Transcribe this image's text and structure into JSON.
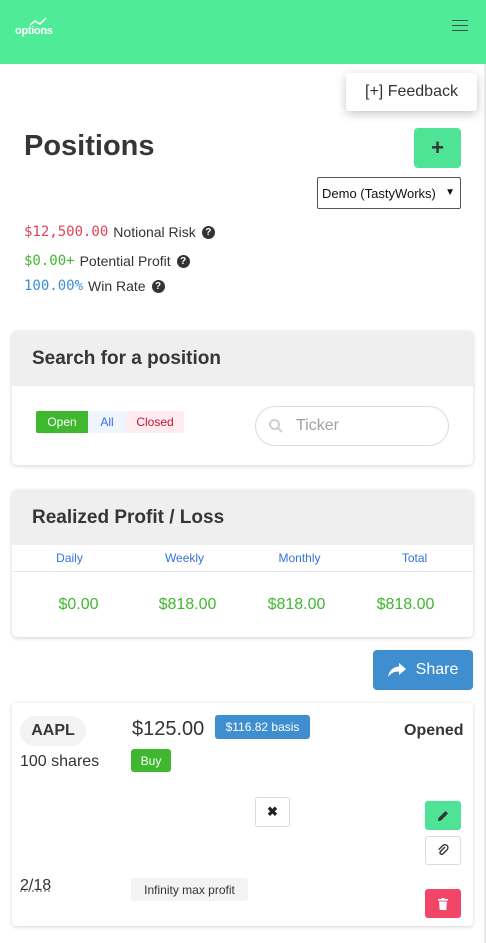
{
  "navbar": {
    "logo_text": "options",
    "bg_color": "#4fec97"
  },
  "feedback": {
    "label": "[+] Feedback"
  },
  "page": {
    "title": "Positions",
    "add_label": "+"
  },
  "account_select": {
    "selected": "Demo (TastyWorks)"
  },
  "stats": {
    "notional_risk": {
      "value": "$12,500.00",
      "label": "Notional Risk",
      "color": "#e0425a"
    },
    "potential_profit": {
      "value": "$0.00+",
      "label": "Potential Profit",
      "color": "#3fb82f"
    },
    "win_rate": {
      "value": "100.00%",
      "label": "Win Rate",
      "color": "#3e8ed0"
    }
  },
  "search": {
    "title": "Search for a position",
    "filters": [
      "Open",
      "All",
      "Closed"
    ],
    "active_filter": "Open",
    "placeholder": "Ticker"
  },
  "realized": {
    "title": "Realized Profit / Loss",
    "columns": [
      {
        "label": "Daily",
        "value": "$0.00"
      },
      {
        "label": "Weekly",
        "value": "$818.00"
      },
      {
        "label": "Monthly",
        "value": "$818.00"
      },
      {
        "label": "Total",
        "value": "$818.00"
      }
    ]
  },
  "share": {
    "label": "Share"
  },
  "position": {
    "ticker": "AAPL",
    "shares": "100 shares",
    "price": "$125.00",
    "basis": "$116.82 basis",
    "action": "Buy",
    "status": "Opened",
    "close_icon": "✖",
    "date": "2/18",
    "max_profit": "Infinity max profit"
  }
}
